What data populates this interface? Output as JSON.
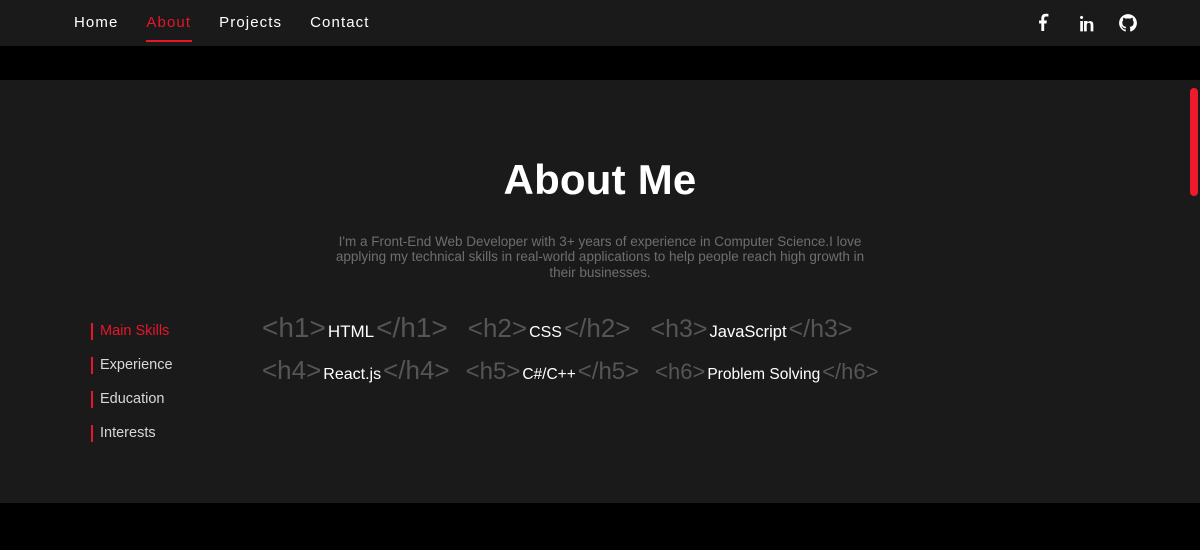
{
  "navbar": {
    "links": [
      {
        "label": "Home",
        "active": false
      },
      {
        "label": "About",
        "active": true
      },
      {
        "label": "Projects",
        "active": false
      },
      {
        "label": "Contact",
        "active": false
      }
    ],
    "socials": [
      {
        "name": "facebook-icon",
        "label": "Facebook"
      },
      {
        "name": "linkedin-icon",
        "label": "LinkedIn"
      },
      {
        "name": "github-icon",
        "label": "GitHub"
      }
    ]
  },
  "about": {
    "title": "About Me",
    "intro": "I'm a Front-End Web Developer with 3+ years of experience in Computer Science.I love applying my technical skills in real-world applications to help people reach high growth in their businesses.",
    "tabs": [
      {
        "label": "Main Skills",
        "active": true
      },
      {
        "label": "Experience",
        "active": false
      },
      {
        "label": "Education",
        "active": false
      },
      {
        "label": "Interests",
        "active": false
      }
    ],
    "skill_rows": [
      [
        {
          "level": "h1",
          "open": "<h1>",
          "name": "HTML",
          "close": "</h1>"
        },
        {
          "level": "h2",
          "open": "<h2>",
          "name": "CSS",
          "close": "</h2>"
        },
        {
          "level": "h3",
          "open": "<h3>",
          "name": "JavaScript",
          "close": "</h3>"
        }
      ],
      [
        {
          "level": "h4",
          "open": "<h4>",
          "name": "React.js",
          "close": "</h4>"
        },
        {
          "level": "h5",
          "open": "<h5>",
          "name": "C#/C++",
          "close": "</h5>"
        },
        {
          "level": "h6",
          "open": "<h6>",
          "name": "Problem Solving",
          "close": "</h6>"
        }
      ]
    ]
  },
  "theme": {
    "accent": "#e8152b",
    "scrollbar": "#ee1b2e",
    "panel_bg": "#1a1a1a",
    "page_bg": "#000000",
    "muted_text": "#6e6e6e",
    "tag_text": "#555555"
  }
}
